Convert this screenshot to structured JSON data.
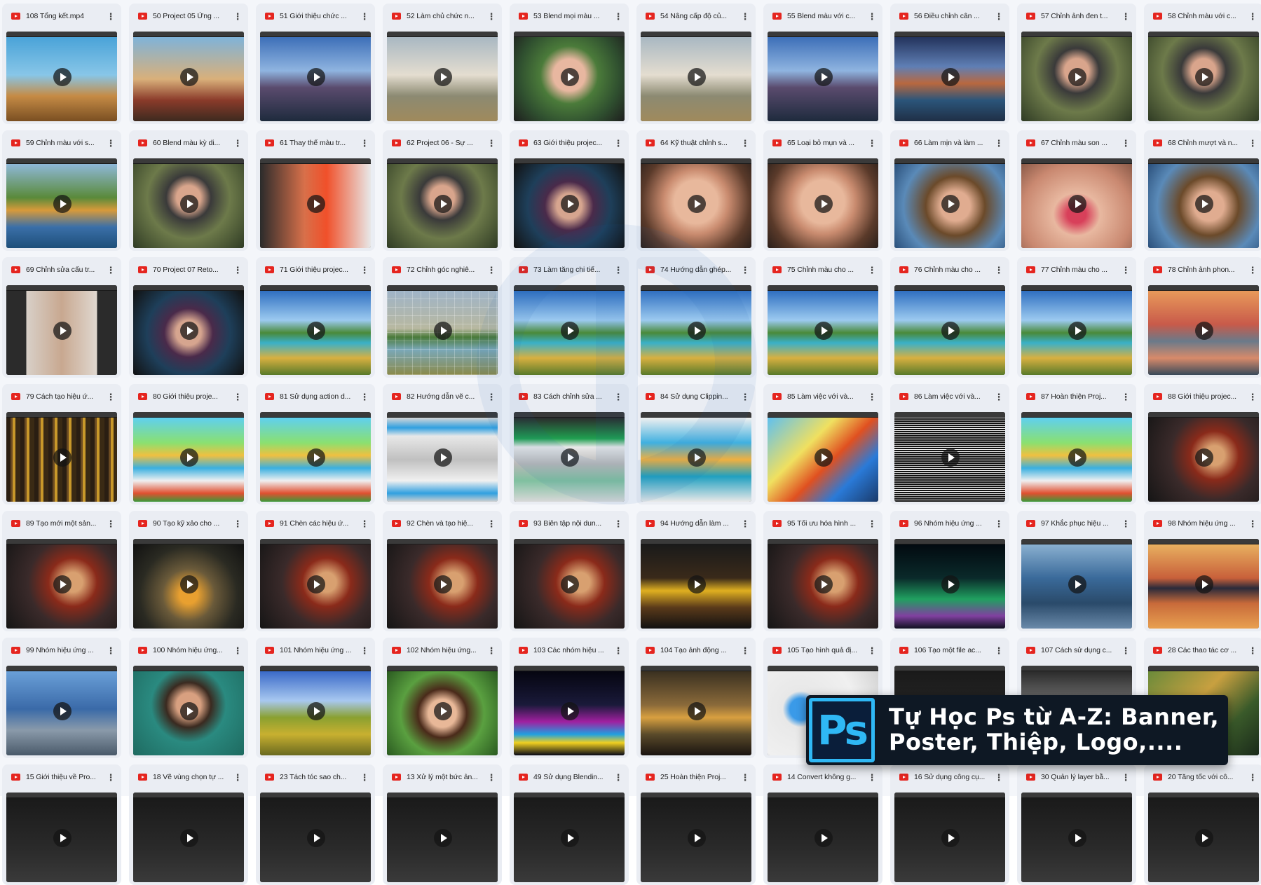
{
  "videos": [
    {
      "title": "108 Tổng kết.mp4",
      "thumb": "safari"
    },
    {
      "title": "50 Project 05 Ứng ...",
      "thumb": "desert"
    },
    {
      "title": "51 Giới thiệu chức ...",
      "thumb": "mountain"
    },
    {
      "title": "52 Làm chủ chức n...",
      "thumb": "cloud"
    },
    {
      "title": "53 Blend mọi màu ...",
      "thumb": "girl"
    },
    {
      "title": "54 Nâng cấp độ củ...",
      "thumb": "cloud"
    },
    {
      "title": "55 Blend màu với c...",
      "thumb": "mountain"
    },
    {
      "title": "56 Điều chỉnh cân ...",
      "thumb": "lake"
    },
    {
      "title": "57 Chỉnh ảnh đen t...",
      "thumb": "portrait"
    },
    {
      "title": "58 Chỉnh màu với c...",
      "thumb": "portrait"
    },
    {
      "title": "59 Chỉnh màu với s...",
      "thumb": "forest"
    },
    {
      "title": "60 Blend màu kỳ di...",
      "thumb": "portrait"
    },
    {
      "title": "61 Thay thế màu tr...",
      "thumb": "redbg"
    },
    {
      "title": "62 Project 06 - Sự ...",
      "thumb": "portrait"
    },
    {
      "title": "63 Giới thiệu projec...",
      "thumb": "darkface"
    },
    {
      "title": "64 Kỹ thuật chỉnh s...",
      "thumb": "face"
    },
    {
      "title": "65 Loại bỏ mụn và ...",
      "thumb": "face"
    },
    {
      "title": "66 Làm mịn và làm ...",
      "thumb": "curly"
    },
    {
      "title": "67 Chỉnh màu son ...",
      "thumb": "lips"
    },
    {
      "title": "68 Chỉnh mượt và n...",
      "thumb": "curly"
    },
    {
      "title": "69 Chỉnh sửa cấu tr...",
      "thumb": "body"
    },
    {
      "title": "70 Project 07 Reto...",
      "thumb": "darkface"
    },
    {
      "title": "71 Giới thiệu projec...",
      "thumb": "island"
    },
    {
      "title": "72 Chỉnh góc nghiê...",
      "thumb": "grid"
    },
    {
      "title": "73 Làm tăng chi tiế...",
      "thumb": "island"
    },
    {
      "title": "74 Hướng dẫn ghép...",
      "thumb": "island"
    },
    {
      "title": "75 Chỉnh màu cho ...",
      "thumb": "island"
    },
    {
      "title": "76 Chỉnh màu cho ...",
      "thumb": "island"
    },
    {
      "title": "77 Chỉnh màu cho ...",
      "thumb": "island"
    },
    {
      "title": "78 Chỉnh ảnh phon...",
      "thumb": "sunset"
    },
    {
      "title": "79 Cách tạo hiệu ứ...",
      "thumb": "woods"
    },
    {
      "title": "80 Giới thiệu proje...",
      "thumb": "game"
    },
    {
      "title": "81 Sử dụng action d...",
      "thumb": "game"
    },
    {
      "title": "82 Hướng dẫn vẽ c...",
      "thumb": "wire"
    },
    {
      "title": "83 Cách chỉnh sửa ...",
      "thumb": "wire2"
    },
    {
      "title": "84 Sử dụng Clippin...",
      "thumb": "game2"
    },
    {
      "title": "85 Làm việc với và...",
      "thumb": "hero"
    },
    {
      "title": "86 Làm việc với và...",
      "thumb": "text"
    },
    {
      "title": "87 Hoàn thiện Proj...",
      "thumb": "game"
    },
    {
      "title": "88 Giới thiệu projec...",
      "thumb": "soldier"
    },
    {
      "title": "89 Tạo mới một sản...",
      "thumb": "soldier"
    },
    {
      "title": "90 Tạo kỹ xảo cho ...",
      "thumb": "war"
    },
    {
      "title": "91 Chèn các hiệu ứ...",
      "thumb": "soldier"
    },
    {
      "title": "92 Chèn và tạo hiệ...",
      "thumb": "soldier"
    },
    {
      "title": "93 Biên tập nội dun...",
      "thumb": "soldier"
    },
    {
      "title": "94 Hướng dẫn làm ...",
      "thumb": "banner"
    },
    {
      "title": "95 Tối ưu hóa hình ...",
      "thumb": "soldier"
    },
    {
      "title": "96 Nhóm hiệu ứng ...",
      "thumb": "lights"
    },
    {
      "title": "97 Khắc phục hiệu ...",
      "thumb": "station"
    },
    {
      "title": "98 Nhóm hiệu ứng ...",
      "thumb": "reflect"
    },
    {
      "title": "99 Nhóm hiệu ứng ...",
      "thumb": "boat"
    },
    {
      "title": "100 Nhóm hiệu ứng...",
      "thumb": "beard"
    },
    {
      "title": "101 Nhóm hiệu ứng ...",
      "thumb": "field"
    },
    {
      "title": "102 Nhóm hiệu ứng...",
      "thumb": "boy"
    },
    {
      "title": "103 Các nhóm hiệu ...",
      "thumb": "city"
    },
    {
      "title": "104 Tạo ảnh động ...",
      "thumb": "rider"
    },
    {
      "title": "105 Tạo hình quả đị...",
      "thumb": "globe"
    },
    {
      "title": "106 Tạo một file ac...",
      "thumb": "dark"
    },
    {
      "title": "107 Cách sử dụng c...",
      "thumb": "grey"
    },
    {
      "title": "28 Các thao tác cơ ...",
      "thumb": "dragon"
    },
    {
      "title": "15 Giới thiệu về Pro...",
      "thumb": "dark"
    },
    {
      "title": "18 Vẽ vùng chọn tự ...",
      "thumb": "dark"
    },
    {
      "title": "23 Tách tóc sao ch...",
      "thumb": "dark"
    },
    {
      "title": "13 Xử lý một bức ản...",
      "thumb": "dark"
    },
    {
      "title": "49 Sử dụng Blendin...",
      "thumb": "dark"
    },
    {
      "title": "25 Hoàn thiện Proj...",
      "thumb": "dark"
    },
    {
      "title": "14 Convert không g...",
      "thumb": "dark"
    },
    {
      "title": "16 Sử dụng công cụ...",
      "thumb": "dark"
    },
    {
      "title": "30 Quản lý layer bằ...",
      "thumb": "dark"
    },
    {
      "title": "20 Tăng tốc với cô...",
      "thumb": "dark"
    }
  ],
  "more_icon": "⋮",
  "promo": {
    "logo_text": "Ps",
    "line1": "Tự Học Ps từ A-Z: Banner,",
    "line2": "Poster, Thiệp, Logo,...."
  },
  "colors": {
    "file_icon": "#e5251f",
    "ps_logo_accent": "#2fb8f5",
    "banner_bg": "#0e1824"
  }
}
